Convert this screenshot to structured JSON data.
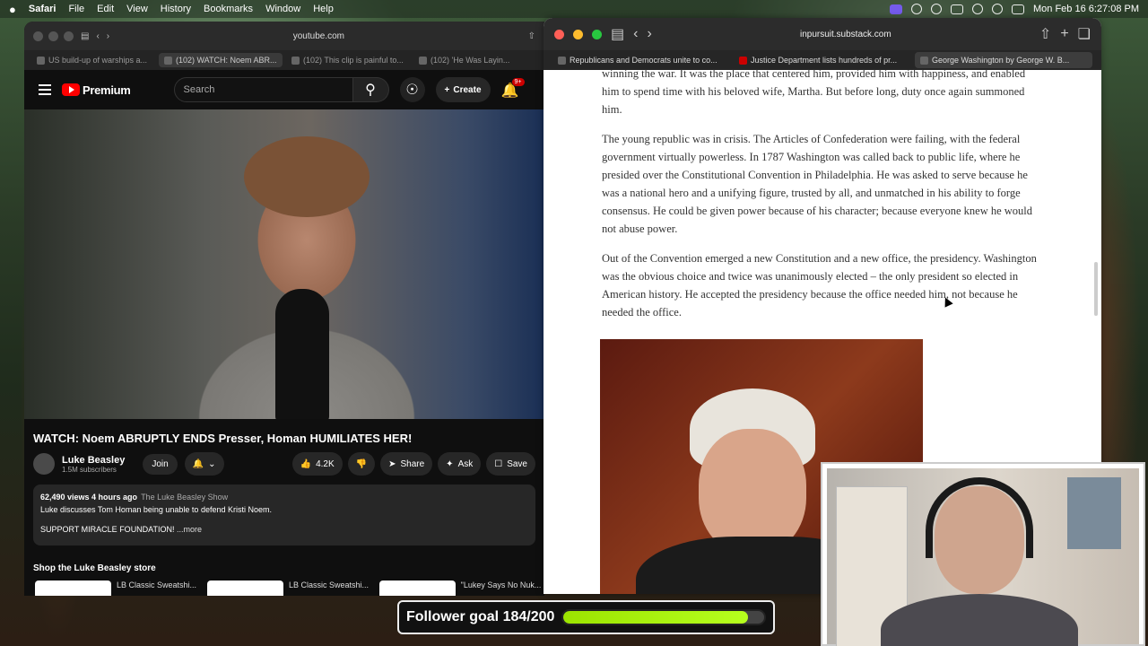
{
  "menubar": {
    "apple": "",
    "items": [
      "Safari",
      "File",
      "Edit",
      "View",
      "History",
      "Bookmarks",
      "Window",
      "Help"
    ],
    "clock": "Mon Feb 16  6:27:08 PM"
  },
  "left_window": {
    "url": "youtube.com",
    "tabs": [
      "US build-up of warships a...",
      "(102) WATCH: Noem ABR...",
      "(102) This clip is painful to...",
      "(102) 'He Was Layin..."
    ],
    "youtube": {
      "logo": "Premium",
      "search_placeholder": "Search",
      "create": "Create",
      "notif_badge": "9+",
      "video_title": "WATCH: Noem ABRUPTLY ENDS Presser, Homan HUMILIATES HER!",
      "channel_name": "Luke Beasley",
      "subscribers": "1.5M subscribers",
      "join": "Join",
      "likes": "4.2K",
      "share": "Share",
      "ask": "Ask",
      "save": "Save",
      "description": {
        "views_time": "62,490 views  4 hours ago",
        "channel_link": "The Luke Beasley Show",
        "line1": "Luke discusses Tom Homan being unable to defend Kristi Noem.",
        "line2": "SUPPORT MIRACLE FOUNDATION!",
        "more": "...more"
      },
      "store_title": "Shop the Luke Beasley store",
      "products": [
        "LB Classic Sweatshi...",
        "LB Classic Sweatshi...",
        "\"Lukey Says No Nuk..."
      ]
    }
  },
  "right_window": {
    "url": "inpursuit.substack.com",
    "tabs": [
      "Republicans and Democrats unite to co...",
      "Justice Department lists hundreds of pr...",
      "George Washington by George W. B..."
    ],
    "paragraphs": [
      "winning the war. It was the place that centered him, provided him with happiness, and enabled him to spend time with his beloved wife, Martha. But before long, duty once again summoned him.",
      "The young republic was in crisis. The Articles of Confederation were failing, with the federal government virtually powerless. In 1787 Washington was called back to public life, where he presided over the Constitutional Convention in Philadelphia. He was asked to serve because he was a national hero and a unifying figure, trusted by all, and unmatched in his ability to forge consensus. He could be given power because of his character; because everyone knew he would not abuse power.",
      "Out of the Convention emerged a new Constitution and a new office, the presidency. Washington was the obvious choice and twice was unanimously elected – the only president so elected in American history. He accepted the presidency because the office needed him, not because he needed the office."
    ]
  },
  "follower_goal": {
    "label": "Follower goal 184/200",
    "progress": 0.92
  }
}
